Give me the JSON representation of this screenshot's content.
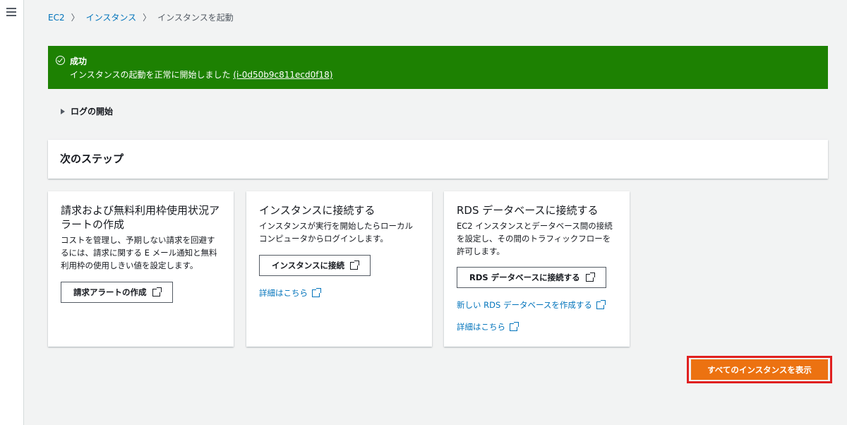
{
  "breadcrumb": {
    "items": [
      "EC2",
      "インスタンス",
      "インスタンスを起動"
    ]
  },
  "flash": {
    "title": "成功",
    "message": "インスタンスの起動を正常に開始しました",
    "instance_link": "(i-0d50b9c811ecd0f18)",
    "color": "#1d8102"
  },
  "log": {
    "label": "ログの開始"
  },
  "next_steps": {
    "heading": "次のステップ"
  },
  "cards": [
    {
      "title": "請求および無料利用枠使用状況アラートの作成",
      "description": "コストを管理し、予期しない請求を回避するには、請求に関する E メール通知と無料利用枠の使用しきい値を設定します。",
      "button": "請求アラートの作成"
    },
    {
      "title": "インスタンスに接続する",
      "description": "インスタンスが実行を開始したらローカルコンピュータからログインします。",
      "button": "インスタンスに接続",
      "link": "詳細はこちら"
    },
    {
      "title": "RDS データベースに接続する",
      "description": "EC2 インスタンスとデータベース間の接続を設定し、その間のトラフィックフローを許可します。",
      "button": "RDS データベースに接続する",
      "link1": "新しい RDS データベースを作成する",
      "link2": "詳細はこちら"
    }
  ],
  "primary_button": {
    "label": "すべてのインスタンスを表示",
    "color": "#ec7211"
  }
}
